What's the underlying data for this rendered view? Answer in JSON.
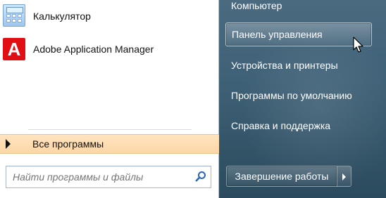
{
  "left": {
    "programs": [
      {
        "label": "Калькулятор",
        "icon": "calculator-icon"
      },
      {
        "label": "Adobe Application Manager",
        "icon": "adobe-icon"
      }
    ],
    "all_programs_label": "Все программы",
    "search": {
      "placeholder": "Найти программы и файлы",
      "value": ""
    }
  },
  "right": {
    "items": [
      {
        "label": "Компьютер"
      },
      {
        "label": "Панель управления"
      },
      {
        "label": "Устройства и принтеры"
      },
      {
        "label": "Программы по умолчанию"
      },
      {
        "label": "Справка и поддержка"
      }
    ],
    "shutdown_label": "Завершение работы"
  },
  "colors": {
    "highlight": "#fcd6a7",
    "right_panel": "#3f6177",
    "adobe_red": "#e10f14"
  }
}
